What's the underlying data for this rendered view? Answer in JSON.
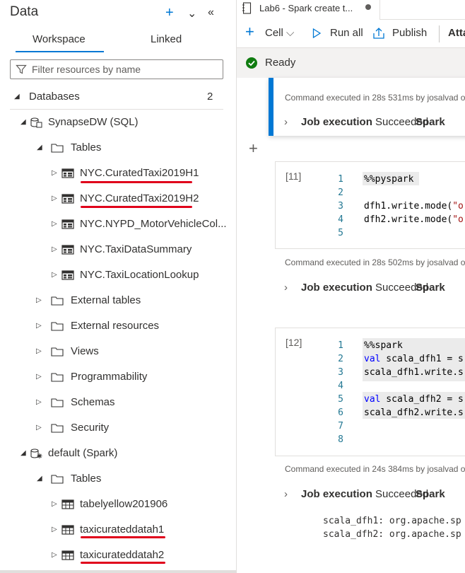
{
  "left_panel": {
    "title": "Data",
    "tabs": [
      "Workspace",
      "Linked"
    ],
    "filter_placeholder": "Filter resources by name",
    "databases_label": "Databases",
    "databases_count": "2",
    "tree": {
      "synapse_db": "SynapseDW (SQL)",
      "tables": "Tables",
      "sql_tables": [
        "NYC.CuratedTaxi2019H1",
        "NYC.CuratedTaxi2019H2",
        "NYC.NYPD_MotorVehicleCol...",
        "NYC.TaxiDataSummary",
        "NYC.TaxiLocationLookup"
      ],
      "folders": [
        "External tables",
        "External resources",
        "Views",
        "Programmability",
        "Schemas",
        "Security"
      ],
      "spark_db": "default (Spark)",
      "spark_tables_label": "Tables",
      "spark_tables": [
        "tabelyellow201906",
        "taxicurateddatah1",
        "taxicurateddatah2"
      ]
    },
    "colors": {
      "accent": "#0078d4",
      "highlight_underline": "#e0001b"
    }
  },
  "notebook": {
    "tab_title": "Lab6 - Spark create t...",
    "toolbar": {
      "cell": "Cell",
      "run_all": "Run all",
      "publish": "Publish",
      "attach": "Atta"
    },
    "status": "Ready",
    "cells": [
      {
        "exec_text": "Command executed in 28s 531ms by josalvad o",
        "job_label": "Job execution",
        "job_status": "Succeeded",
        "job_engine": "Spark"
      },
      {
        "count": "[11]",
        "line_numbers": [
          "1",
          "2",
          "3",
          "4",
          "5"
        ],
        "magic": "%%pyspark",
        "lines": [
          {
            "plain": "dfh1.write.mode(",
            "str": "\"o"
          },
          {
            "plain": "dfh2.write.mode(",
            "str": "\"o"
          }
        ],
        "exec_text": "Command executed in 28s 502ms by josalvad o",
        "job_label": "Job execution",
        "job_status": "Succeeded",
        "job_engine": "Spark"
      },
      {
        "count": "[12]",
        "line_numbers": [
          "1",
          "2",
          "3",
          "4",
          "5",
          "6",
          "7",
          "8"
        ],
        "magic": "%%spark",
        "line2_kw": "val",
        "line2_rest": " scala_dfh1 = s",
        "line3": "scala_dfh1.write.s",
        "line5_kw": "val",
        "line5_rest": " scala_dfh2 = s",
        "line6": "scala_dfh2.write.s",
        "exec_text": "Command executed in 24s 384ms by josalvad o",
        "job_label": "Job execution",
        "job_status": "Succeeded",
        "job_engine": "Spark",
        "output": [
          "scala_dfh1: org.apache.sp",
          "scala_dfh2: org.apache.sp"
        ]
      }
    ]
  }
}
